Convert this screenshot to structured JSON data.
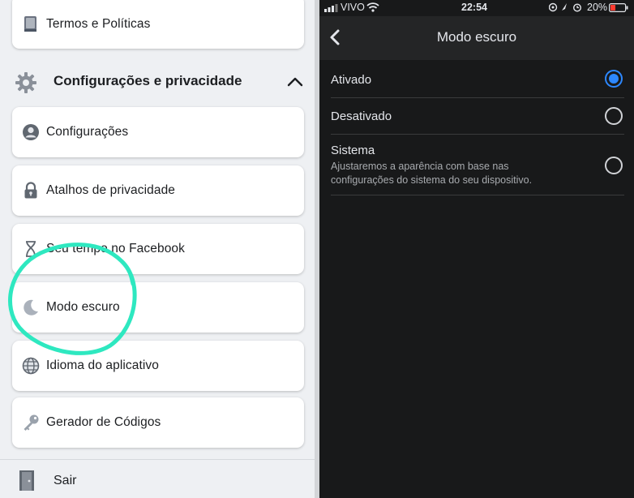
{
  "left_menu": {
    "cards": [
      {
        "label": "Termos e Políticas",
        "icon": "book-icon"
      },
      {
        "label": "Configurações",
        "icon": "profile-icon"
      },
      {
        "label": "Atalhos de privacidade",
        "icon": "lock-icon"
      },
      {
        "label": "Seu tempo no Facebook",
        "icon": "hourglass-icon"
      },
      {
        "label": "Modo escuro",
        "icon": "moon-icon"
      },
      {
        "label": "Idioma do aplicativo",
        "icon": "globe-icon"
      },
      {
        "label": "Gerador de Códigos",
        "icon": "key-icon"
      }
    ],
    "section_header": {
      "label": "Configurações e privacidade",
      "icon": "gear-icon",
      "expanded": true
    },
    "logout": {
      "label": "Sair",
      "icon": "door-icon"
    },
    "annotation_color": "#2ee8c0"
  },
  "status_bar": {
    "carrier": "VIVO",
    "time": "22:54",
    "battery": "20%"
  },
  "dark_mode_screen": {
    "title": "Modo escuro",
    "options": [
      {
        "label": "Ativado",
        "description": "",
        "selected": true
      },
      {
        "label": "Desativado",
        "description": "",
        "selected": false
      },
      {
        "label": "Sistema",
        "description": "Ajustaremos a aparência com base nas configurações do sistema do seu dispositivo.",
        "selected": false
      }
    ],
    "accent_color": "#2d88ff"
  }
}
